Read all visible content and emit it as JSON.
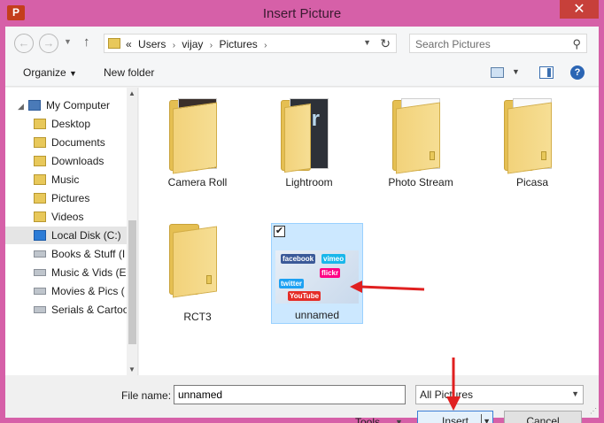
{
  "window": {
    "title": "Insert Picture",
    "app_icon": "P",
    "close": "✕"
  },
  "nav": {
    "back": "←",
    "forward": "→",
    "up": "↑",
    "breadcrumb": [
      "«",
      "Users",
      "vijay",
      "Pictures"
    ],
    "search_placeholder": "Search Pictures"
  },
  "toolbar": {
    "organize": "Organize",
    "new_folder": "New folder",
    "help": "?"
  },
  "tree": [
    {
      "label": "My Computer",
      "icon": "computer-icon",
      "level": 0
    },
    {
      "label": "Desktop",
      "icon": "folder-icon",
      "level": 1
    },
    {
      "label": "Documents",
      "icon": "folder-icon",
      "level": 1
    },
    {
      "label": "Downloads",
      "icon": "folder-icon",
      "level": 1
    },
    {
      "label": "Music",
      "icon": "folder-icon",
      "level": 1
    },
    {
      "label": "Pictures",
      "icon": "folder-icon",
      "level": 1
    },
    {
      "label": "Videos",
      "icon": "folder-icon",
      "level": 1
    },
    {
      "label": "Local Disk (C:)",
      "icon": "windows-drive-icon",
      "level": 1,
      "selected": true
    },
    {
      "label": "Books & Stuff (I",
      "icon": "drive-icon",
      "level": 1
    },
    {
      "label": "Music & Vids (E",
      "icon": "drive-icon",
      "level": 1
    },
    {
      "label": "Movies & Pics (",
      "icon": "drive-icon",
      "level": 1
    },
    {
      "label": "Serials & Cartoo",
      "icon": "drive-icon",
      "level": 1
    }
  ],
  "files": [
    {
      "name": "Camera Roll",
      "type": "folder"
    },
    {
      "name": "Lightroom",
      "type": "folder",
      "badge": "Lr"
    },
    {
      "name": "Photo Stream",
      "type": "folder"
    },
    {
      "name": "Picasa",
      "type": "folder"
    },
    {
      "name": "RCT3",
      "type": "folder"
    },
    {
      "name": "unnamed",
      "type": "image",
      "selected": true,
      "checked": "✔"
    }
  ],
  "thumb_logos": [
    "facebook",
    "flickr",
    "twitter",
    "vimeo",
    "YouTube"
  ],
  "bottom": {
    "file_name_label": "File name:",
    "file_name_value": "unnamed",
    "filter": "All Pictures",
    "tools": "Tools",
    "insert": "Insert",
    "cancel": "Cancel"
  },
  "colors": {
    "window_frame": "#d660a8",
    "close_button": "#c7403a",
    "selection": "#cce8ff",
    "annotation_arrow": "#e02020"
  }
}
